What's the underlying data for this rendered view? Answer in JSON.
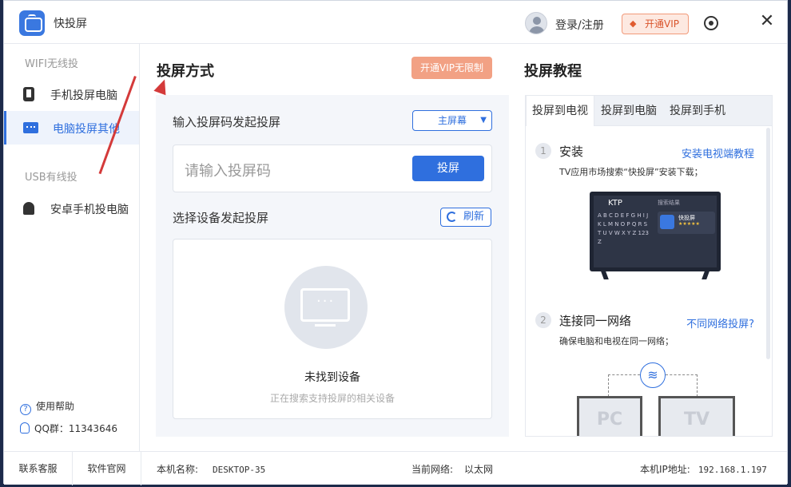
{
  "app": {
    "title": "快投屏"
  },
  "header": {
    "login_label": "登录/注册",
    "vip_label": "开通VIP"
  },
  "sidebar": {
    "wifi_section": "WIFI无线投",
    "usb_section": "USB有线投",
    "items": [
      {
        "label": "手机投屏电脑",
        "icon": "phone-icon"
      },
      {
        "label": "电脑投屏其他",
        "icon": "monitor-icon"
      },
      {
        "label": "安卓手机投电脑",
        "icon": "android-icon"
      }
    ],
    "help_label": "使用帮助",
    "qq_label": "QQ群：11343646"
  },
  "main": {
    "title": "投屏方式",
    "vip_unlimited_label": "开通VIP无限制",
    "code_section_label": "输入投屏码发起投屏",
    "screen_select_value": "主屏幕",
    "code_placeholder": "请输入投屏码",
    "cast_button_label": "投屏",
    "device_section_label": "选择设备发起投屏",
    "refresh_label": "刷新",
    "empty_title": "未找到设备",
    "empty_sub": "正在搜索支持投屏的相关设备"
  },
  "tutorial": {
    "title": "投屏教程",
    "tabs": [
      {
        "label": "投屏到电视"
      },
      {
        "label": "投屏到电脑"
      },
      {
        "label": "投屏到手机"
      }
    ],
    "steps": [
      {
        "num": "1",
        "title": "安装",
        "link": "安装电视端教程",
        "desc": "TV应用市场搜索“快投屏”安装下载；"
      },
      {
        "num": "2",
        "title": "连接同一网络",
        "link": "不同网络投屏?",
        "desc": "确保电脑和电视在同一网络；"
      }
    ],
    "tv_mock": {
      "search_text": "KTP",
      "results_label": "搜索结果",
      "app_name": "快投屏",
      "keys": "A B C D E F G H I J K L M N O P Q R S T U V W X Y Z 123 Z"
    },
    "device_pc": "PC",
    "device_tv": "TV"
  },
  "statusbar": {
    "contact_label": "联系客服",
    "website_label": "软件官网",
    "hostname_label": "本机名称:",
    "hostname_value": "DESKTOP-35",
    "network_label": "当前网络:",
    "network_value": "以太网",
    "ip_label": "本机IP地址:",
    "ip_value": "192.168.1.197"
  },
  "colors": {
    "accent": "#2f6fde",
    "vip": "#f2a184",
    "annotation_arrow": "#d43a3a"
  }
}
